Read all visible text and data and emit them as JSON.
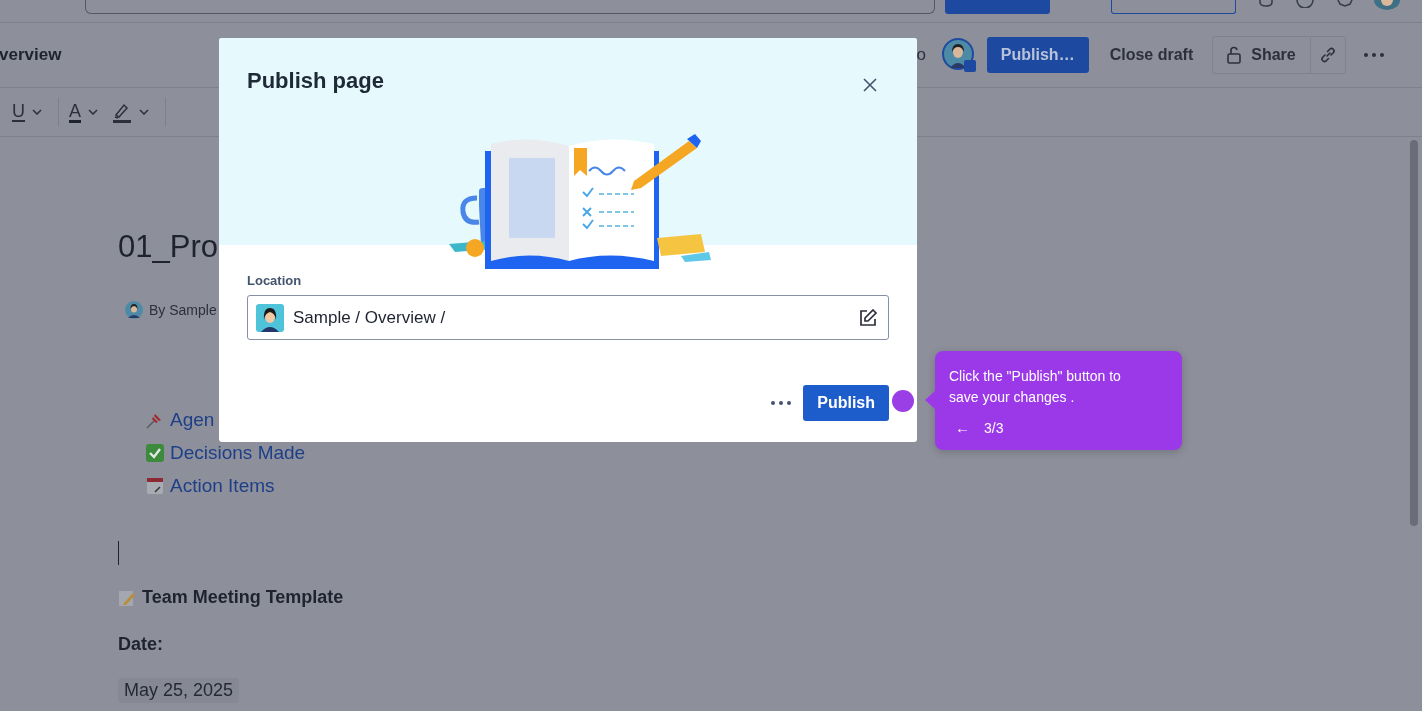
{
  "header": {
    "page_title": "verview",
    "collaborator_fragment": "o",
    "publish_button": "Publish…",
    "close_draft_button": "Close draft",
    "share_button": "Share"
  },
  "toolbar": {
    "underline": "U",
    "text_color": "A"
  },
  "document": {
    "title": "01_Pro",
    "byline": "By Sample",
    "links": [
      {
        "kind": "pin",
        "label": "Agen"
      },
      {
        "kind": "check",
        "label": "Decisions Made"
      },
      {
        "kind": "calendar",
        "label": "Action Items"
      }
    ],
    "heading": "Team Meeting Template",
    "date_label": "Date:",
    "date": "May 25, 2025"
  },
  "dialog": {
    "title": "Publish page",
    "location_label": "Location",
    "location": "Sample / Overview /",
    "publish_button": "Publish"
  },
  "tour": {
    "text": "Click the \"Publish\" button to save your changes .",
    "back": "←",
    "step": "3/3"
  }
}
